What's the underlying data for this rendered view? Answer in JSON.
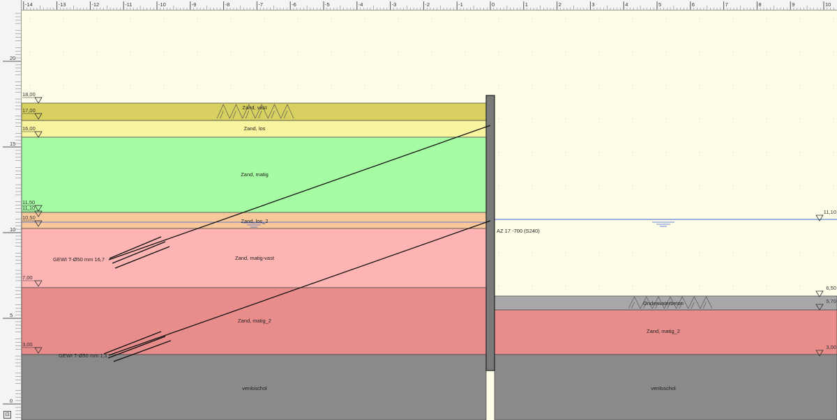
{
  "rulers": {
    "x_ticks": [
      "-14",
      "-13",
      "-12",
      "-11",
      "-10",
      "-9",
      "-8",
      "-7",
      "-6",
      "-5",
      "-4",
      "-3",
      "-2",
      "-1",
      "0",
      "1",
      "2",
      "3",
      "4",
      "5",
      "6",
      "7",
      "8",
      "9",
      "10"
    ],
    "y_ticks": [
      "20",
      "15",
      "10",
      "5",
      "0"
    ]
  },
  "corner_button": "⊡",
  "left_levels": [
    "18,00",
    "17,00",
    "16,00",
    "11,50",
    "11,10",
    "10,50",
    "7,00",
    "3,00"
  ],
  "right_levels": [
    "11,10",
    "6,50",
    "5,70",
    "3,00"
  ],
  "left_layers": [
    {
      "name": "Zand, vast",
      "color": "#d8d060"
    },
    {
      "name": "Zand, los",
      "color": "#f8f4a0"
    },
    {
      "name": "Zand, matig",
      "color": "#a6fca2"
    },
    {
      "name": "Zand, los_2",
      "color": "#f8c89a"
    },
    {
      "name": "Zand, matig-vast",
      "color": "#ffb4b4"
    },
    {
      "name": "Zand, matig_2",
      "color": "#e88c8c"
    },
    {
      "name": "venloschol",
      "color": "#8a8a8a"
    }
  ],
  "right_layers": [
    {
      "name": "Onderwaterbeton",
      "color": "#a8a8a8"
    },
    {
      "name": "Zand, matig_2",
      "color": "#e88c8c"
    },
    {
      "name": "venloschol",
      "color": "#8a8a8a"
    }
  ],
  "sheet_pile_label": "AZ 17 -700 (S240)",
  "anchors": [
    {
      "label": "GEWI T-Ø50 mm 16,7"
    },
    {
      "label": "GEWI T-Ø50 mm 1,1"
    }
  ],
  "colors": {
    "sky": "#fefee8",
    "water_line": "#4060d0",
    "wall": "#7a7a7a"
  }
}
